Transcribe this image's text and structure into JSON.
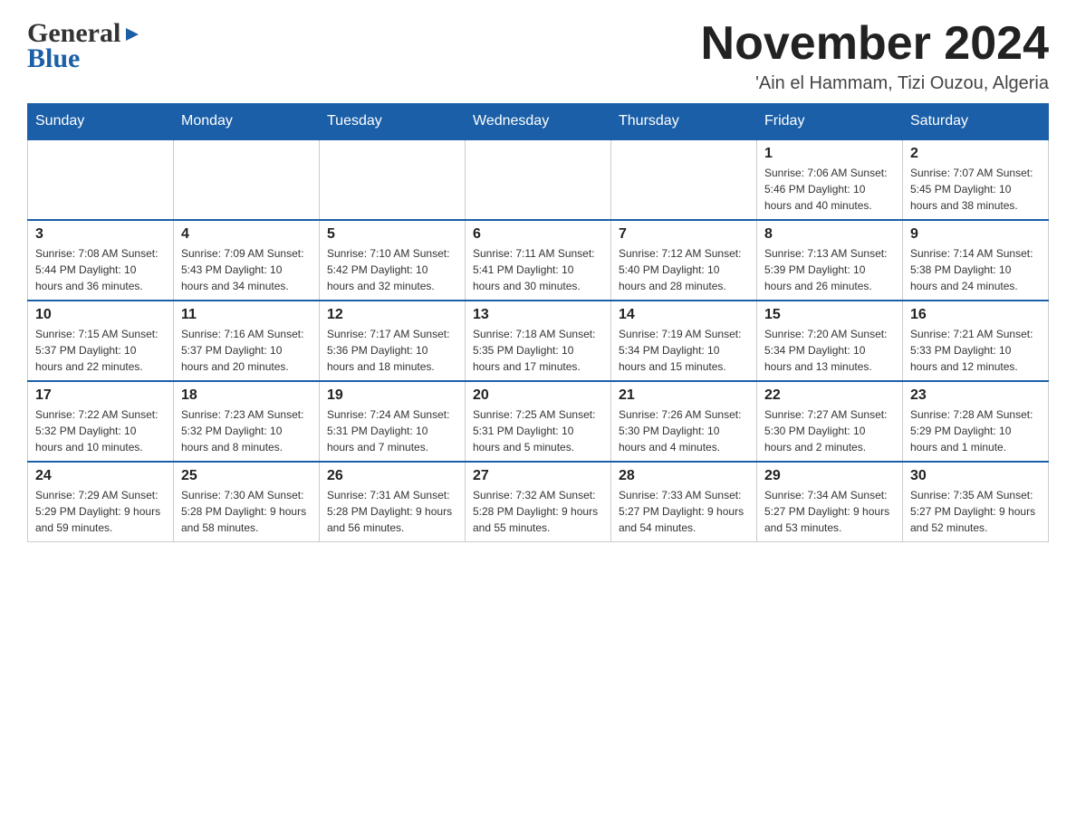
{
  "header": {
    "logo": {
      "general": "General",
      "blue": "Blue",
      "triangle": "▶"
    },
    "title": "November 2024",
    "location": "'Ain el Hammam, Tizi Ouzou, Algeria"
  },
  "days_of_week": [
    "Sunday",
    "Monday",
    "Tuesday",
    "Wednesday",
    "Thursday",
    "Friday",
    "Saturday"
  ],
  "weeks": [
    {
      "days": [
        {
          "num": "",
          "info": ""
        },
        {
          "num": "",
          "info": ""
        },
        {
          "num": "",
          "info": ""
        },
        {
          "num": "",
          "info": ""
        },
        {
          "num": "",
          "info": ""
        },
        {
          "num": "1",
          "info": "Sunrise: 7:06 AM\nSunset: 5:46 PM\nDaylight: 10 hours\nand 40 minutes."
        },
        {
          "num": "2",
          "info": "Sunrise: 7:07 AM\nSunset: 5:45 PM\nDaylight: 10 hours\nand 38 minutes."
        }
      ]
    },
    {
      "days": [
        {
          "num": "3",
          "info": "Sunrise: 7:08 AM\nSunset: 5:44 PM\nDaylight: 10 hours\nand 36 minutes."
        },
        {
          "num": "4",
          "info": "Sunrise: 7:09 AM\nSunset: 5:43 PM\nDaylight: 10 hours\nand 34 minutes."
        },
        {
          "num": "5",
          "info": "Sunrise: 7:10 AM\nSunset: 5:42 PM\nDaylight: 10 hours\nand 32 minutes."
        },
        {
          "num": "6",
          "info": "Sunrise: 7:11 AM\nSunset: 5:41 PM\nDaylight: 10 hours\nand 30 minutes."
        },
        {
          "num": "7",
          "info": "Sunrise: 7:12 AM\nSunset: 5:40 PM\nDaylight: 10 hours\nand 28 minutes."
        },
        {
          "num": "8",
          "info": "Sunrise: 7:13 AM\nSunset: 5:39 PM\nDaylight: 10 hours\nand 26 minutes."
        },
        {
          "num": "9",
          "info": "Sunrise: 7:14 AM\nSunset: 5:38 PM\nDaylight: 10 hours\nand 24 minutes."
        }
      ]
    },
    {
      "days": [
        {
          "num": "10",
          "info": "Sunrise: 7:15 AM\nSunset: 5:37 PM\nDaylight: 10 hours\nand 22 minutes."
        },
        {
          "num": "11",
          "info": "Sunrise: 7:16 AM\nSunset: 5:37 PM\nDaylight: 10 hours\nand 20 minutes."
        },
        {
          "num": "12",
          "info": "Sunrise: 7:17 AM\nSunset: 5:36 PM\nDaylight: 10 hours\nand 18 minutes."
        },
        {
          "num": "13",
          "info": "Sunrise: 7:18 AM\nSunset: 5:35 PM\nDaylight: 10 hours\nand 17 minutes."
        },
        {
          "num": "14",
          "info": "Sunrise: 7:19 AM\nSunset: 5:34 PM\nDaylight: 10 hours\nand 15 minutes."
        },
        {
          "num": "15",
          "info": "Sunrise: 7:20 AM\nSunset: 5:34 PM\nDaylight: 10 hours\nand 13 minutes."
        },
        {
          "num": "16",
          "info": "Sunrise: 7:21 AM\nSunset: 5:33 PM\nDaylight: 10 hours\nand 12 minutes."
        }
      ]
    },
    {
      "days": [
        {
          "num": "17",
          "info": "Sunrise: 7:22 AM\nSunset: 5:32 PM\nDaylight: 10 hours\nand 10 minutes."
        },
        {
          "num": "18",
          "info": "Sunrise: 7:23 AM\nSunset: 5:32 PM\nDaylight: 10 hours\nand 8 minutes."
        },
        {
          "num": "19",
          "info": "Sunrise: 7:24 AM\nSunset: 5:31 PM\nDaylight: 10 hours\nand 7 minutes."
        },
        {
          "num": "20",
          "info": "Sunrise: 7:25 AM\nSunset: 5:31 PM\nDaylight: 10 hours\nand 5 minutes."
        },
        {
          "num": "21",
          "info": "Sunrise: 7:26 AM\nSunset: 5:30 PM\nDaylight: 10 hours\nand 4 minutes."
        },
        {
          "num": "22",
          "info": "Sunrise: 7:27 AM\nSunset: 5:30 PM\nDaylight: 10 hours\nand 2 minutes."
        },
        {
          "num": "23",
          "info": "Sunrise: 7:28 AM\nSunset: 5:29 PM\nDaylight: 10 hours\nand 1 minute."
        }
      ]
    },
    {
      "days": [
        {
          "num": "24",
          "info": "Sunrise: 7:29 AM\nSunset: 5:29 PM\nDaylight: 9 hours\nand 59 minutes."
        },
        {
          "num": "25",
          "info": "Sunrise: 7:30 AM\nSunset: 5:28 PM\nDaylight: 9 hours\nand 58 minutes."
        },
        {
          "num": "26",
          "info": "Sunrise: 7:31 AM\nSunset: 5:28 PM\nDaylight: 9 hours\nand 56 minutes."
        },
        {
          "num": "27",
          "info": "Sunrise: 7:32 AM\nSunset: 5:28 PM\nDaylight: 9 hours\nand 55 minutes."
        },
        {
          "num": "28",
          "info": "Sunrise: 7:33 AM\nSunset: 5:27 PM\nDaylight: 9 hours\nand 54 minutes."
        },
        {
          "num": "29",
          "info": "Sunrise: 7:34 AM\nSunset: 5:27 PM\nDaylight: 9 hours\nand 53 minutes."
        },
        {
          "num": "30",
          "info": "Sunrise: 7:35 AM\nSunset: 5:27 PM\nDaylight: 9 hours\nand 52 minutes."
        }
      ]
    }
  ]
}
